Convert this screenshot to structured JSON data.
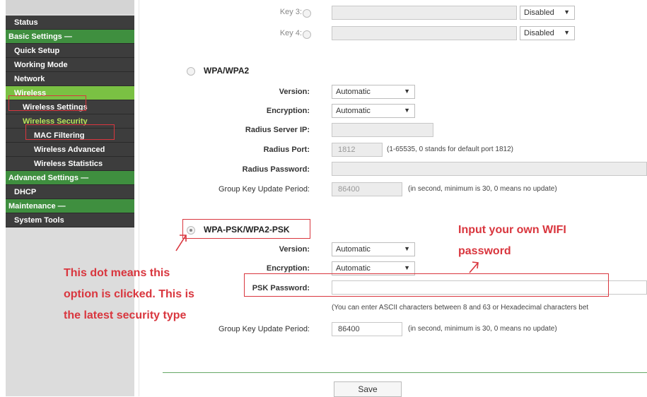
{
  "sidebar": {
    "items": [
      {
        "label": "Status"
      },
      {
        "label": "Basic Settings —"
      },
      {
        "label": "Quick Setup"
      },
      {
        "label": "Working Mode"
      },
      {
        "label": "Network"
      },
      {
        "label": "Wireless"
      },
      {
        "label": "Wireless Settings"
      },
      {
        "label": "Wireless Security"
      },
      {
        "label": "MAC Filtering"
      },
      {
        "label": "Wireless Advanced"
      },
      {
        "label": "Wireless Statistics"
      },
      {
        "label": "Advanced Settings —"
      },
      {
        "label": "DHCP"
      },
      {
        "label": "Maintenance —"
      },
      {
        "label": "System Tools"
      }
    ]
  },
  "wep_keys": {
    "key3_label": "Key 3:",
    "key4_label": "Key 4:",
    "key3_type": "Disabled",
    "key4_type": "Disabled"
  },
  "wpa": {
    "title": "WPA/WPA2",
    "version_label": "Version:",
    "version_value": "Automatic",
    "encryption_label": "Encryption:",
    "encryption_value": "Automatic",
    "radius_ip_label": "Radius Server IP:",
    "radius_port_label": "Radius Port:",
    "radius_port_value": "1812",
    "radius_port_hint": "(1-65535, 0 stands for default port 1812)",
    "radius_password_label": "Radius Password:",
    "group_key_label": "Group Key Update Period:",
    "group_key_value": "86400",
    "group_key_hint": "(in second, minimum is 30, 0 means no update)"
  },
  "wpa_psk": {
    "title": "WPA-PSK/WPA2-PSK",
    "version_label": "Version:",
    "version_value": "Automatic",
    "encryption_label": "Encryption:",
    "encryption_value": "Automatic",
    "psk_label": "PSK Password:",
    "psk_value": "",
    "psk_hint": "(You can enter ASCII characters between 8 and 63 or Hexadecimal characters bet",
    "group_key_label": "Group Key Update Period:",
    "group_key_value": "86400",
    "group_key_hint": "(in second, minimum is 30, 0 means no update)"
  },
  "save_label": "Save",
  "annotations": {
    "dot_line1": "This dot means this",
    "dot_line2": "option is clicked. This is",
    "dot_line3": "the latest security type",
    "wifi_line1": "Input your own WIFI",
    "wifi_line2": "password"
  },
  "icons": {
    "dropdown": "chevron-down-icon",
    "radio_off": "radio-unselected-icon",
    "radio_on": "radio-selected-icon",
    "arrow": "arrow-icon"
  },
  "colors": {
    "nav_dark": "#3d3d3d",
    "nav_group": "#3f8f3f",
    "nav_active": "#7ac143",
    "annotation": "#d9363e"
  }
}
